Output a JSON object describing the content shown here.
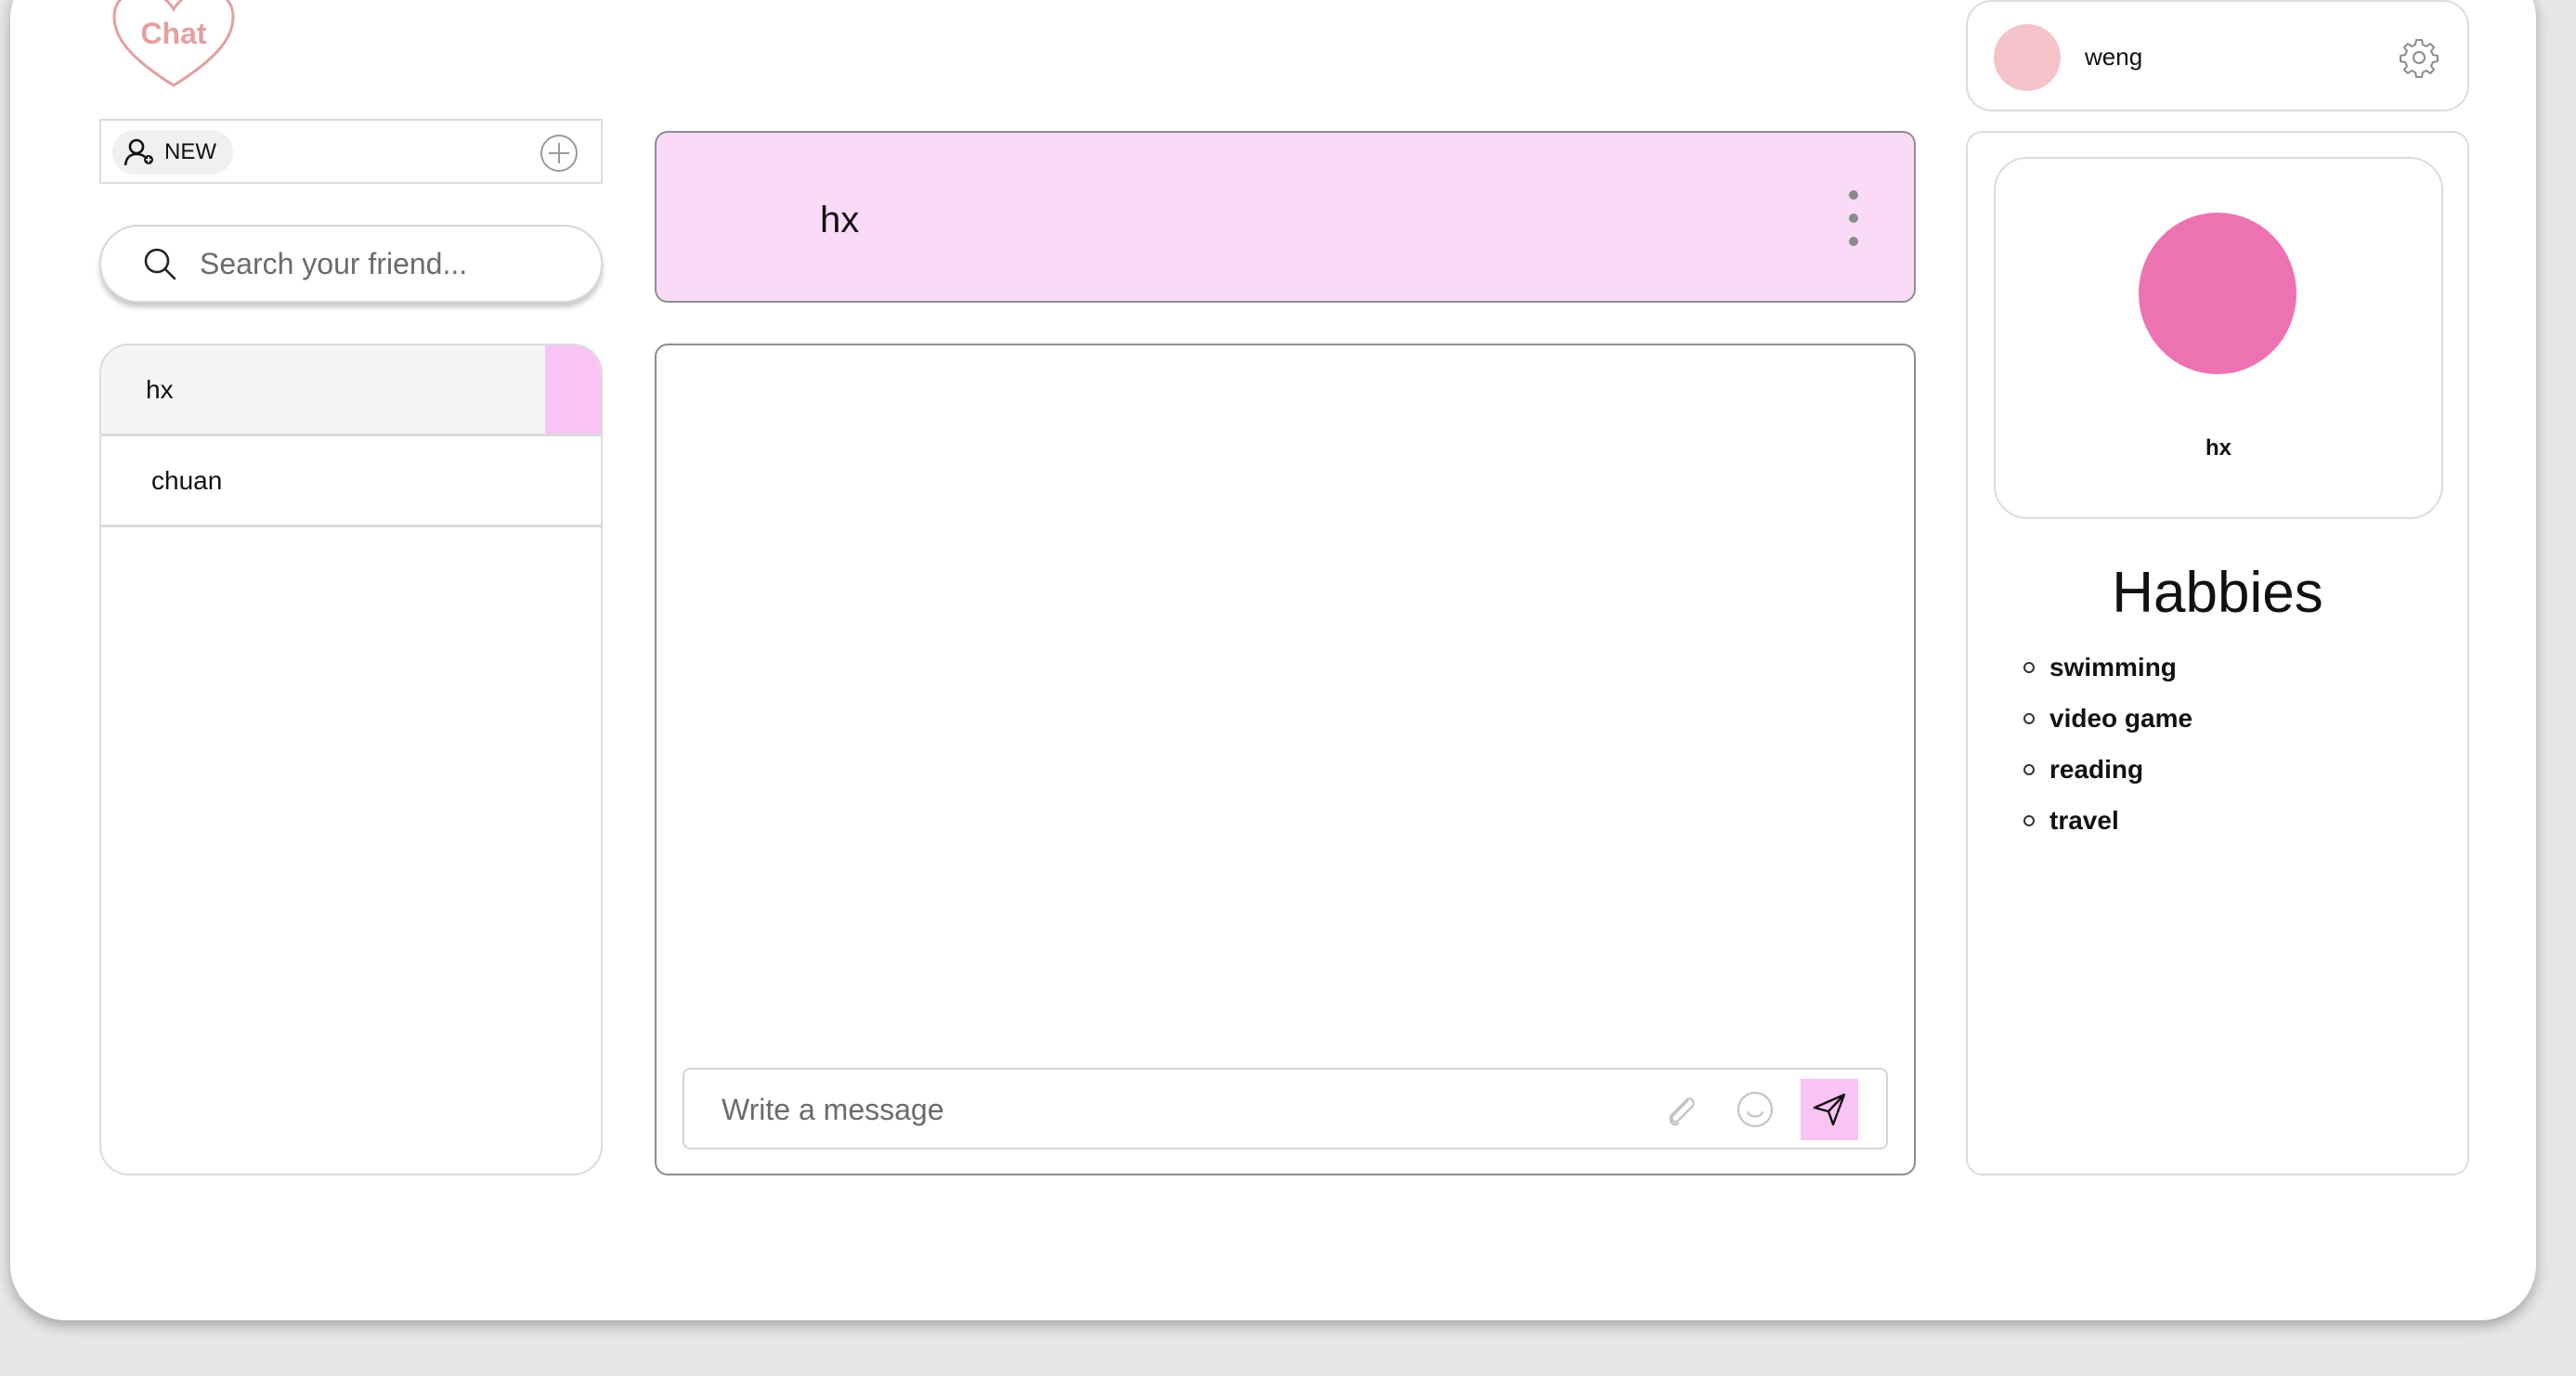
{
  "app": {
    "logo_text": "Chat"
  },
  "sidebar": {
    "new_label": "NEW",
    "search_placeholder": "Search your friend...",
    "friends": [
      {
        "name": "hx",
        "active": true
      },
      {
        "name": "chuan",
        "active": false
      }
    ]
  },
  "chat": {
    "header_name": "hx",
    "message_placeholder": "Write a message"
  },
  "user": {
    "name": "weng"
  },
  "profile": {
    "name": "hx",
    "hobbies_title": "Habbies",
    "hobbies": [
      "swimming",
      "video game",
      "reading",
      "travel"
    ]
  },
  "colors": {
    "accent_pink": "#f7c4f3",
    "header_pink": "#f9dbf7",
    "avatar_pink": "#ed72b2",
    "user_avatar": "#f4c2c9",
    "logo": "#e3a0a0"
  },
  "icons": [
    "heart-logo-icon",
    "add-user-icon",
    "plus-icon",
    "search-icon",
    "more-vertical-icon",
    "paperclip-icon",
    "smiley-icon",
    "send-icon",
    "gear-icon"
  ]
}
